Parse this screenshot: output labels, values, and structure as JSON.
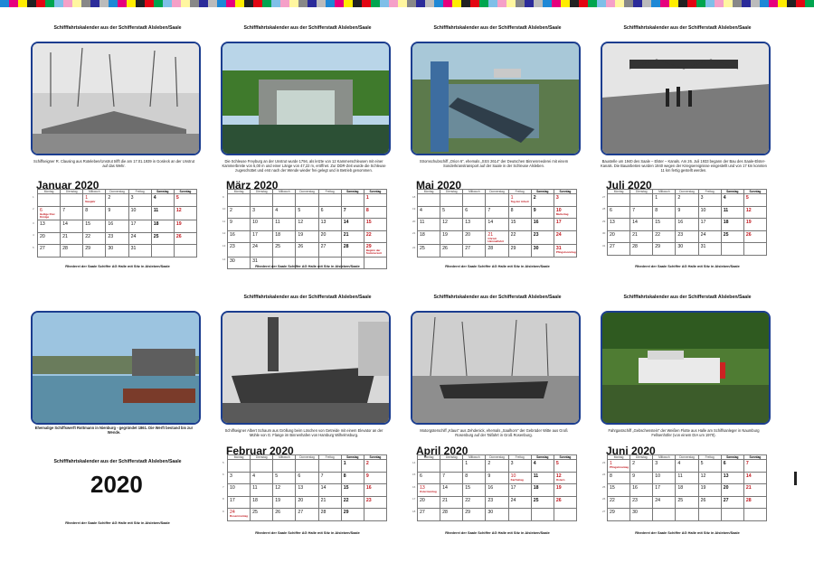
{
  "header_title": "Schifffahrtskalender aus der Schifferstadt Alsleben/Saale",
  "footer_text": "Rhederei der Saale Schiffer AG Halle mit Sitz in Alsleben/Saale",
  "weekdays": [
    "Montag",
    "Dienstag",
    "Mittwoch",
    "Donnerstag",
    "Freitag",
    "Samstag",
    "Sonntag"
  ],
  "cover": {
    "title": "Schifffahrtskalender aus der Schifferstadt Alsleben/Saale",
    "year": "2020",
    "caption": "Ehemalige Schiffswerft Rottmann in Nienburg - gegründet 1861. Die Werft bestand bis zur Wende.",
    "footer": "Rhederei der Saale Schiffer AG Halle mit Sitz in Alsleben/Saale"
  },
  "months": [
    {
      "name": "Januar 2020",
      "caption": "Schiffseigner R. Clausing aus Roteleben/Unstrut trifft die am 17.01.1939 in Gosleck an der Unstrut auf das Wehr.",
      "weeks": [
        "1",
        "2",
        "3",
        "4",
        "5"
      ],
      "rows": [
        [
          "",
          "",
          "1",
          "2",
          "3",
          "4",
          "5"
        ],
        [
          "6",
          "7",
          "8",
          "9",
          "10",
          "11",
          "12"
        ],
        [
          "13",
          "14",
          "15",
          "16",
          "17",
          "18",
          "19"
        ],
        [
          "20",
          "21",
          "22",
          "23",
          "24",
          "25",
          "26"
        ],
        [
          "27",
          "28",
          "29",
          "30",
          "31",
          "",
          ""
        ]
      ],
      "holidays": [
        [
          "1",
          "Neujahr"
        ],
        [
          "6",
          "Heilige Drei Könige"
        ]
      ]
    },
    {
      "name": "März 2020",
      "caption": "Die Schleuse Freyburg an der Unstrut wurde 1794, als letzte von 12 Kammerschleusen mit einer Kammerbreite von 5,00 m und einer Länge von 47,22 m, eröffnet. Zur DDR-Zeit wurde die Schleuse zugeschüttet und erst nach der Wende wieder frei gelegt und in Betrieb genommen.",
      "weeks": [
        "9",
        "10",
        "11",
        "12",
        "13",
        "14"
      ],
      "rows": [
        [
          "",
          "",
          "",
          "",
          "",
          "",
          "1"
        ],
        [
          "2",
          "3",
          "4",
          "5",
          "6",
          "7",
          "8"
        ],
        [
          "9",
          "10",
          "11",
          "12",
          "13",
          "14",
          "15"
        ],
        [
          "16",
          "17",
          "18",
          "19",
          "20",
          "21",
          "22"
        ],
        [
          "23",
          "24",
          "25",
          "26",
          "27",
          "28",
          "29"
        ],
        [
          "30",
          "31",
          "",
          "",
          "",
          "",
          ""
        ]
      ],
      "holidays": [
        [
          "29",
          "Beginn der Sommerzeit"
        ]
      ]
    },
    {
      "name": "Mai 2020",
      "caption": "Stromschubschiff „Orion 6“, ehemals „SSS 2614“ der Deutschen Binnenreederei mit einem Sonderkranstransport auf der Saale in der Schleuse Alsleben.",
      "weeks": [
        "18",
        "19",
        "20",
        "21",
        "22"
      ],
      "rows": [
        [
          "",
          "",
          "",
          "",
          "1",
          "2",
          "3"
        ],
        [
          "4",
          "5",
          "6",
          "7",
          "8",
          "9",
          "10"
        ],
        [
          "11",
          "12",
          "13",
          "14",
          "15",
          "16",
          "17"
        ],
        [
          "18",
          "19",
          "20",
          "21",
          "22",
          "23",
          "24"
        ],
        [
          "25",
          "26",
          "27",
          "28",
          "29",
          "30",
          "31"
        ]
      ],
      "holidays": [
        [
          "1",
          "Tag der Arbeit"
        ],
        [
          "10",
          "Muttertag"
        ],
        [
          "21",
          "Christi Himmelfahrt"
        ],
        [
          "31",
          "Pfingstsonntag"
        ]
      ]
    },
    {
      "name": "Juli 2020",
      "caption": "Baustelle um 1940 des Saale – Elster – Kanals. Am 26. Juli 1933 begann der Bau des Saale-Elster-Kanals. Die Bauarbeiten wurden 1940 wegen der Kriegsereignisse eingestellt und von 17 km konnten 11 km fertig gestellt werden.",
      "weeks": [
        "27",
        "28",
        "29",
        "30",
        "31"
      ],
      "rows": [
        [
          "",
          "",
          "1",
          "2",
          "3",
          "4",
          "5"
        ],
        [
          "6",
          "7",
          "8",
          "9",
          "10",
          "11",
          "12"
        ],
        [
          "13",
          "14",
          "15",
          "16",
          "17",
          "18",
          "19"
        ],
        [
          "20",
          "21",
          "22",
          "23",
          "24",
          "25",
          "26"
        ],
        [
          "27",
          "28",
          "29",
          "30",
          "31",
          "",
          ""
        ]
      ],
      "holidays": []
    },
    {
      "name": "Februar 2020",
      "caption": "Schiffseigner Albert Schaum aus Gröllung beim Löschen von Getreide mit einem Elevator an der Mühle von G. Flange im Binnenhafen von Hamburg Wilhelmsburg.",
      "weeks": [
        "5",
        "6",
        "7",
        "8",
        "9"
      ],
      "rows": [
        [
          "",
          "",
          "",
          "",
          "",
          "1",
          "2"
        ],
        [
          "3",
          "4",
          "5",
          "6",
          "7",
          "8",
          "9"
        ],
        [
          "10",
          "11",
          "12",
          "13",
          "14",
          "15",
          "16"
        ],
        [
          "17",
          "18",
          "19",
          "20",
          "21",
          "22",
          "23"
        ],
        [
          "24",
          "25",
          "26",
          "27",
          "28",
          "29",
          ""
        ]
      ],
      "holidays": [
        [
          "24",
          "Rosenmontag"
        ]
      ]
    },
    {
      "name": "April 2020",
      "caption": "Motorgüterschiff „Klaus“ aus Zehdenick, ehemals „Saalhorn“ der Gebrüder Witte aus Groß Rosenburg auf der Talfahrt in Groß Rosenburg.",
      "weeks": [
        "14",
        "15",
        "16",
        "17",
        "18"
      ],
      "rows": [
        [
          "",
          "",
          "1",
          "2",
          "3",
          "4",
          "5"
        ],
        [
          "6",
          "7",
          "8",
          "9",
          "10",
          "11",
          "12"
        ],
        [
          "13",
          "14",
          "15",
          "16",
          "17",
          "18",
          "19"
        ],
        [
          "20",
          "21",
          "22",
          "23",
          "24",
          "25",
          "26"
        ],
        [
          "27",
          "28",
          "29",
          "30",
          "",
          "",
          ""
        ]
      ],
      "holidays": [
        [
          "10",
          "Karfreitag"
        ],
        [
          "12",
          "Ostern"
        ],
        [
          "13",
          "Ostermontag"
        ]
      ]
    },
    {
      "name": "Juni 2020",
      "caption": "Fahrgastschiff „Gebschenstein“ der Weißen Flotte aus Halle am Schiffsanleger in Naumburg Fellsenhöfer (von einem DIA um 1970).",
      "weeks": [
        "23",
        "24",
        "25",
        "26",
        "27"
      ],
      "rows": [
        [
          "1",
          "2",
          "3",
          "4",
          "5",
          "6",
          "7"
        ],
        [
          "8",
          "9",
          "10",
          "11",
          "12",
          "13",
          "14"
        ],
        [
          "15",
          "16",
          "17",
          "18",
          "19",
          "20",
          "21"
        ],
        [
          "22",
          "23",
          "24",
          "25",
          "26",
          "27",
          "28"
        ],
        [
          "29",
          "30",
          "",
          "",
          "",
          "",
          ""
        ]
      ],
      "holidays": [
        [
          "1",
          "Pfingstmontag"
        ]
      ]
    }
  ],
  "colors": {
    "frame": "#1b3d8f",
    "holiday": "#c0161c"
  }
}
